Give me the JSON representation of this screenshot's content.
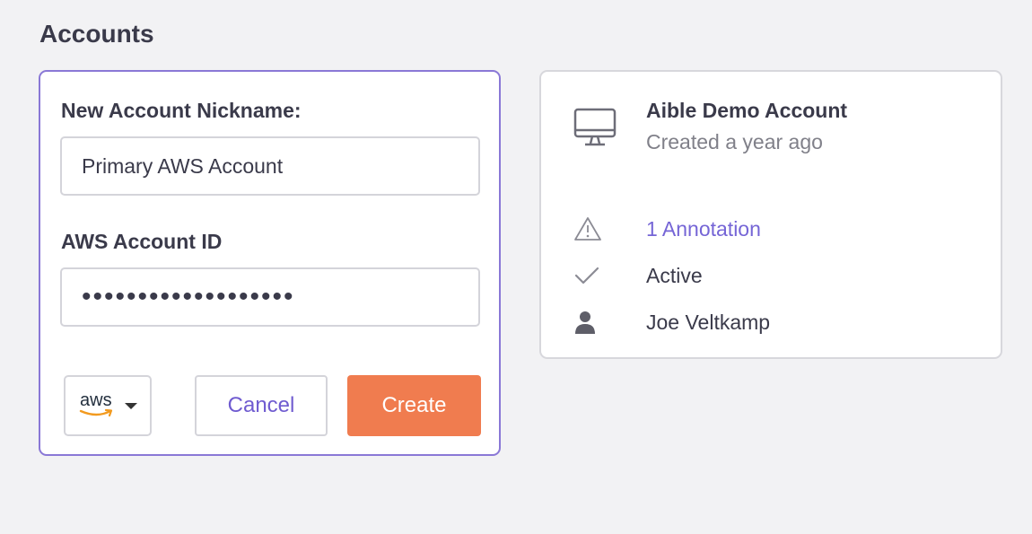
{
  "header": {
    "title": "Accounts"
  },
  "form": {
    "nickname_label": "New Account Nickname:",
    "nickname_value": "Primary AWS Account",
    "account_id_label": "AWS Account ID",
    "account_id_value": "•••••••••••••••••••",
    "provider": {
      "label": "aws",
      "icon": "aws-logo"
    },
    "cancel_label": "Cancel",
    "create_label": "Create"
  },
  "account_card": {
    "name": "Aible Demo Account",
    "created": "Created a year ago",
    "annotations": "1 Annotation",
    "status": "Active",
    "owner": "Joe Veltkamp"
  },
  "colors": {
    "accent": "#7565d6",
    "create_button": "#f07c4f",
    "card_border_active": "#8a78d6"
  }
}
